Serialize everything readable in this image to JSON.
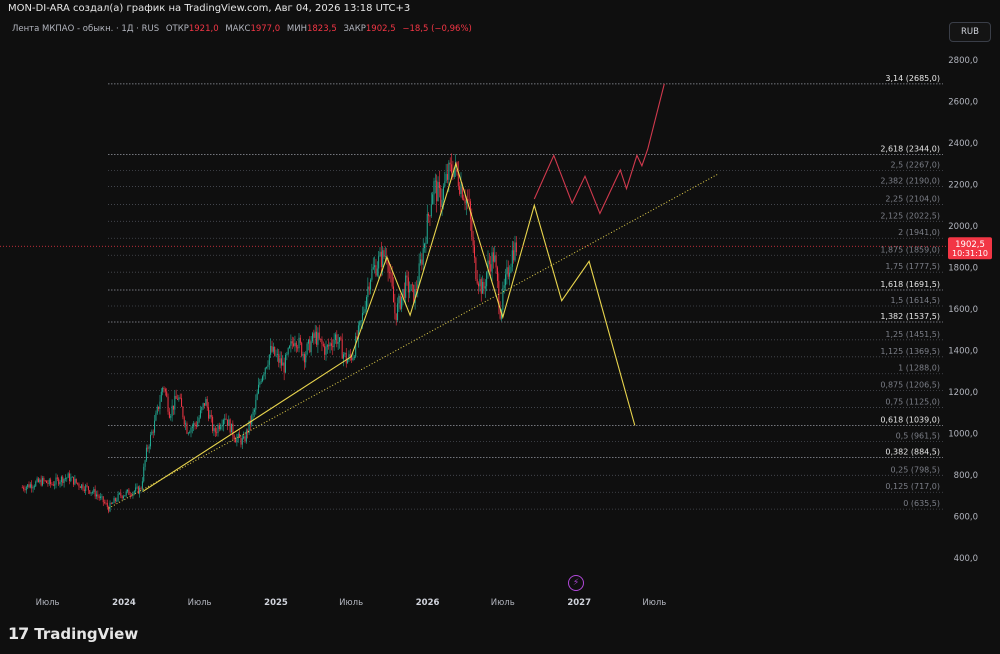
{
  "header": {
    "attribution": "MON-DI-ARA создал(а) график на TradingView.com, Авг 04, 2026 13:18 UTC+3"
  },
  "symbol": {
    "name": "Лента МКПАО - обыкн. · 1Д · RUS",
    "open_label": "ОТКР",
    "open": "1921,0",
    "high_label": "МАКС",
    "high": "1977,0",
    "low_label": "МИН",
    "low": "1823,5",
    "close_label": "ЗАКР",
    "close": "1902,5",
    "change": "−18,5 (−0,96%)"
  },
  "currency_button": "RUB",
  "price_badge": {
    "price": "1902,5",
    "countdown": "10:31:10",
    "color": "#f23645"
  },
  "footer": {
    "brand": "TradingView"
  },
  "chart_data": {
    "type": "candlestick",
    "y_axis": {
      "ticks": [
        {
          "value": 2800,
          "label": "2800,0"
        },
        {
          "value": 2600,
          "label": "2600,0"
        },
        {
          "value": 2400,
          "label": "2400,0"
        },
        {
          "value": 2200,
          "label": "2200,0"
        },
        {
          "value": 2000,
          "label": "2000,0"
        },
        {
          "value": 1800,
          "label": "1800,0"
        },
        {
          "value": 1600,
          "label": "1600,0"
        },
        {
          "value": 1400,
          "label": "1400,0"
        },
        {
          "value": 1200,
          "label": "1200,0"
        },
        {
          "value": 1000,
          "label": "1000,0"
        },
        {
          "value": 800,
          "label": "800,0"
        },
        {
          "value": 600,
          "label": "600,0"
        },
        {
          "value": 400,
          "label": "400,0"
        }
      ],
      "range": [
        250,
        2900
      ]
    },
    "x_axis": {
      "ticks": [
        {
          "date": "2023-07-01",
          "label": "Июль"
        },
        {
          "date": "2024-01-01",
          "label": "2024"
        },
        {
          "date": "2024-07-01",
          "label": "Июль"
        },
        {
          "date": "2025-01-01",
          "label": "2025"
        },
        {
          "date": "2025-07-01",
          "label": "Июль"
        },
        {
          "date": "2026-01-01",
          "label": "2026"
        },
        {
          "date": "2026-07-01",
          "label": "Июль"
        },
        {
          "date": "2027-01-01",
          "label": "2027"
        },
        {
          "date": "2027-07-01",
          "label": "Июль"
        }
      ]
    },
    "fib_levels": [
      {
        "ratio": "3,14",
        "value": 2685.0,
        "label": "3,14 (2685,0)",
        "major": true
      },
      {
        "ratio": "2,618",
        "value": 2344.0,
        "label": "2,618 (2344,0)",
        "major": true
      },
      {
        "ratio": "2,5",
        "value": 2267.0,
        "label": "2,5 (2267,0)",
        "major": false
      },
      {
        "ratio": "2,382",
        "value": 2190.0,
        "label": "2,382 (2190,0)",
        "major": false
      },
      {
        "ratio": "2,25",
        "value": 2104.0,
        "label": "2,25 (2104,0)",
        "major": false
      },
      {
        "ratio": "2,125",
        "value": 2022.5,
        "label": "2,125 (2022,5)",
        "major": false
      },
      {
        "ratio": "2",
        "value": 1941.0,
        "label": "2 (1941,0)",
        "major": false
      },
      {
        "ratio": "1,875",
        "value": 1859.0,
        "label": "1,875 (1859,0)",
        "major": false
      },
      {
        "ratio": "1,75",
        "value": 1777.5,
        "label": "1,75 (1777,5)",
        "major": false
      },
      {
        "ratio": "1,618",
        "value": 1691.5,
        "label": "1,618 (1691,5)",
        "major": true
      },
      {
        "ratio": "1,5",
        "value": 1614.5,
        "label": "1,5 (1614,5)",
        "major": false
      },
      {
        "ratio": "1,382",
        "value": 1537.5,
        "label": "1,382 (1537,5)",
        "major": true
      },
      {
        "ratio": "1,25",
        "value": 1451.5,
        "label": "1,25 (1451,5)",
        "major": false
      },
      {
        "ratio": "1,125",
        "value": 1369.5,
        "label": "1,125 (1369,5)",
        "major": false
      },
      {
        "ratio": "1",
        "value": 1288.0,
        "label": "1 (1288,0)",
        "major": false
      },
      {
        "ratio": "0,875",
        "value": 1206.5,
        "label": "0,875 (1206,5)",
        "major": false
      },
      {
        "ratio": "0,75",
        "value": 1125.0,
        "label": "0,75 (1125,0)",
        "major": false
      },
      {
        "ratio": "0,618",
        "value": 1039.0,
        "label": "0,618 (1039,0)",
        "major": true
      },
      {
        "ratio": "0,5",
        "value": 961.5,
        "label": "0,5 (961,5)",
        "major": false
      },
      {
        "ratio": "0,382",
        "value": 884.5,
        "label": "0,382 (884,5)",
        "major": true
      },
      {
        "ratio": "0,25",
        "value": 798.5,
        "label": "0,25 (798,5)",
        "major": false
      },
      {
        "ratio": "0,125",
        "value": 717.0,
        "label": "0,125 (717,0)",
        "major": false
      },
      {
        "ratio": "0",
        "value": 635.5,
        "label": "0 (635,5)",
        "major": false
      }
    ],
    "price_path": [
      [
        "2023-05-01",
        740
      ],
      [
        "2023-06-01",
        760
      ],
      [
        "2023-06-20",
        770
      ],
      [
        "2023-07-10",
        755
      ],
      [
        "2023-08-01",
        780
      ],
      [
        "2023-08-20",
        790
      ],
      [
        "2023-09-10",
        760
      ],
      [
        "2023-10-01",
        740
      ],
      [
        "2023-10-25",
        710
      ],
      [
        "2023-11-15",
        665
      ],
      [
        "2023-11-25",
        640
      ],
      [
        "2023-12-20",
        700
      ],
      [
        "2024-01-20",
        720
      ],
      [
        "2024-02-10",
        730
      ],
      [
        "2024-02-25",
        920
      ],
      [
        "2024-03-15",
        1050
      ],
      [
        "2024-04-05",
        1240
      ],
      [
        "2024-04-20",
        1100
      ],
      [
        "2024-05-10",
        1180
      ],
      [
        "2024-06-01",
        1020
      ],
      [
        "2024-06-25",
        1050
      ],
      [
        "2024-07-15",
        1160
      ],
      [
        "2024-08-05",
        1000
      ],
      [
        "2024-08-30",
        1090
      ],
      [
        "2024-09-25",
        980
      ],
      [
        "2024-10-15",
        960
      ],
      [
        "2024-11-10",
        1110
      ],
      [
        "2024-11-25",
        1270
      ],
      [
        "2024-12-20",
        1400
      ],
      [
        "2025-01-20",
        1320
      ],
      [
        "2025-02-15",
        1470
      ],
      [
        "2025-03-10",
        1380
      ],
      [
        "2025-04-05",
        1470
      ],
      [
        "2025-05-01",
        1400
      ],
      [
        "2025-05-25",
        1470
      ],
      [
        "2025-06-20",
        1350
      ],
      [
        "2025-07-05",
        1380
      ],
      [
        "2025-07-25",
        1530
      ],
      [
        "2025-08-15",
        1760
      ],
      [
        "2025-09-05",
        1830
      ],
      [
        "2025-09-25",
        1870
      ],
      [
        "2025-10-15",
        1570
      ],
      [
        "2025-11-10",
        1720
      ],
      [
        "2025-12-01",
        1660
      ],
      [
        "2025-12-20",
        1870
      ],
      [
        "2026-01-15",
        2200
      ],
      [
        "2026-02-01",
        2130
      ],
      [
        "2026-02-20",
        2250
      ],
      [
        "2026-03-05",
        2290
      ],
      [
        "2026-03-20",
        2210
      ],
      [
        "2026-04-10",
        2100
      ],
      [
        "2026-04-25",
        1800
      ],
      [
        "2026-05-15",
        1680
      ],
      [
        "2026-05-25",
        1800
      ],
      [
        "2026-06-10",
        1860
      ],
      [
        "2026-06-25",
        1590
      ],
      [
        "2026-07-10",
        1750
      ],
      [
        "2026-07-25",
        1880
      ],
      [
        "2026-08-04",
        1902.5
      ]
    ],
    "annotations": {
      "trendline": {
        "from": [
          "2023-11-25",
          640
        ],
        "to": [
          "2027-12-01",
          2250
        ],
        "color": "#e8d44d",
        "style": "dotted"
      },
      "yellow_wave": {
        "color": "#e8d44d",
        "points": [
          [
            "2024-02-15",
            720
          ],
          [
            "2025-07-01",
            1370
          ],
          [
            "2025-09-25",
            1850
          ],
          [
            "2025-11-20",
            1570
          ],
          [
            "2026-03-10",
            2300
          ],
          [
            "2026-07-01",
            1560
          ],
          [
            "2026-09-15",
            2100
          ],
          [
            "2026-11-20",
            1640
          ],
          [
            "2027-01-25",
            1830
          ],
          [
            "2027-05-15",
            1039
          ]
        ]
      },
      "red_wave": {
        "color": "#d0394d",
        "points": [
          [
            "2026-09-15",
            2130
          ],
          [
            "2026-11-01",
            2340
          ],
          [
            "2026-12-15",
            2110
          ],
          [
            "2027-01-15",
            2240
          ],
          [
            "2027-02-20",
            2060
          ],
          [
            "2027-04-10",
            2270
          ],
          [
            "2027-04-25",
            2180
          ],
          [
            "2027-05-20",
            2340
          ],
          [
            "2027-06-01",
            2290
          ],
          [
            "2027-06-15",
            2370
          ],
          [
            "2027-07-25",
            2685
          ]
        ]
      }
    },
    "colors": {
      "up": "#22ab94",
      "down": "#f23645",
      "background": "#0f0f0f"
    }
  }
}
